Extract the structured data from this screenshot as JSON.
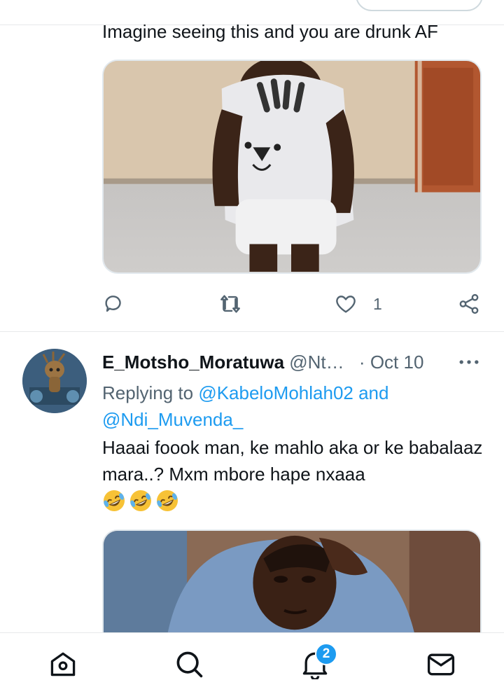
{
  "tweet1": {
    "text": "Imagine seeing this and you are drunk AF",
    "actions": {
      "reply_count": "",
      "retweet_count": "",
      "like_count": "1"
    }
  },
  "tweet2": {
    "display_name": "E_Motsho_Moratuwa",
    "handle": "@Nt…",
    "separator": "·",
    "date": "Oct 10",
    "replying_prefix": "Replying to",
    "mention1": "@KabeloMohlah02",
    "conjunction": "and",
    "mention2": "@Ndi_Muvenda_",
    "body": "Haaai foook man, ke mahlo aka or ke babalaaz mara..? Mxm mbore hape nxaaa",
    "emojis": [
      "rolling-on-floor-laughing",
      "rolling-on-floor-laughing",
      "rolling-on-floor-laughing"
    ]
  },
  "bottom_nav": {
    "items": [
      "home-icon",
      "search-icon",
      "notifications-icon",
      "messages-icon"
    ],
    "notifications_badge": "2"
  },
  "colors": {
    "accent": "#1d9bf0",
    "text_primary": "#0f1419",
    "text_secondary": "#536471",
    "divider": "#e7e9ea"
  }
}
